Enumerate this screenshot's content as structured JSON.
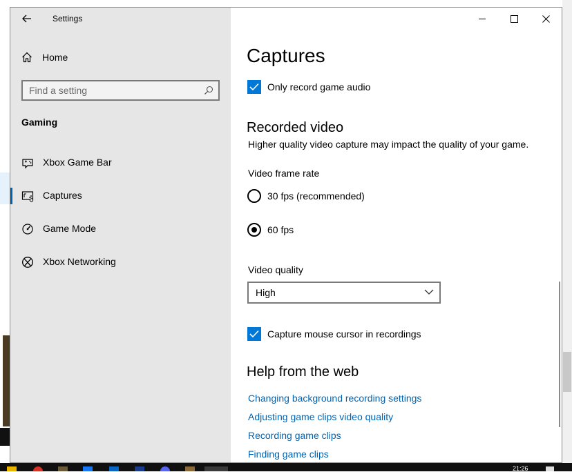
{
  "window": {
    "app_title": "Settings"
  },
  "sidebar": {
    "home_label": "Home",
    "search_placeholder": "Find a setting",
    "section_title": "Gaming",
    "items": [
      {
        "label": "Xbox Game Bar",
        "icon": "xbox-game-bar-icon",
        "selected": false
      },
      {
        "label": "Captures",
        "icon": "captures-icon",
        "selected": true
      },
      {
        "label": "Game Mode",
        "icon": "game-mode-icon",
        "selected": false
      },
      {
        "label": "Xbox Networking",
        "icon": "xbox-icon",
        "selected": false
      }
    ]
  },
  "main": {
    "page_title": "Captures",
    "only_record_game_audio": {
      "label": "Only record game audio",
      "checked": true
    },
    "recorded_video": {
      "heading": "Recorded video",
      "description": "Higher quality video capture may impact the quality of your game.",
      "frame_rate_label": "Video frame rate",
      "frame_rate_options": [
        {
          "label": "30 fps (recommended)",
          "selected": false
        },
        {
          "label": "60 fps",
          "selected": true
        }
      ],
      "quality_label": "Video quality",
      "quality_value": "High",
      "capture_cursor": {
        "label": "Capture mouse cursor in recordings",
        "checked": true
      }
    },
    "help": {
      "heading": "Help from the web",
      "links": [
        "Changing background recording settings",
        "Adjusting game clips video quality",
        "Recording game clips",
        "Finding game clips"
      ]
    }
  },
  "colors": {
    "accent": "#0078d7",
    "link": "#0063b1",
    "sidebar_bg": "#e6e6e6"
  },
  "taskbar": {
    "clock": "21:26"
  }
}
